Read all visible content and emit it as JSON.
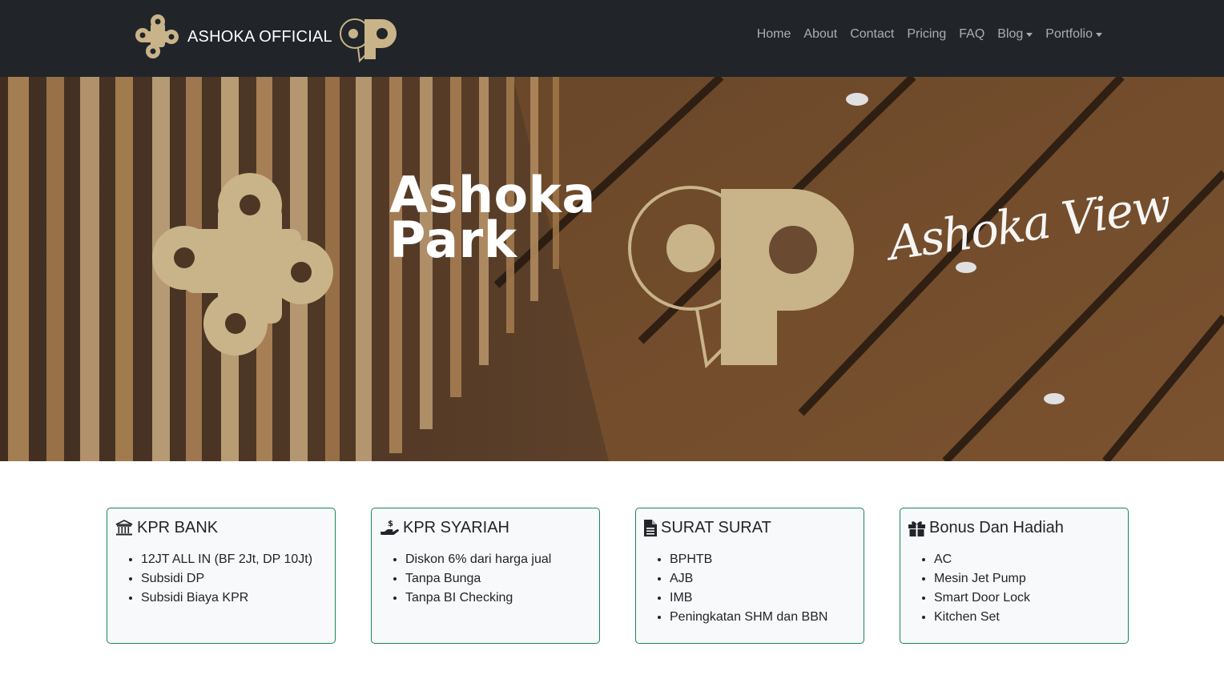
{
  "navbar": {
    "brand_text": "ASHOKA OFFICIAL",
    "links": [
      {
        "label": "Home"
      },
      {
        "label": "About"
      },
      {
        "label": "Contact"
      },
      {
        "label": "Pricing"
      },
      {
        "label": "FAQ"
      },
      {
        "label": "Blog"
      },
      {
        "label": "Portfolio"
      }
    ]
  },
  "hero": {
    "title_line1": "Ashoka",
    "title_line2": "Park",
    "script_text": "Ashoka View",
    "logo_color": "#c9b48a"
  },
  "cards": [
    {
      "icon": "bank-icon",
      "title": "KPR BANK",
      "items": [
        "12JT ALL IN (BF 2Jt, DP 10Jt)",
        "Subsidi DP",
        "Subsidi Biaya KPR"
      ]
    },
    {
      "icon": "hand-dollar-icon",
      "title": "KPR SYARIAH",
      "items": [
        "Diskon 6% dari harga jual",
        "Tanpa Bunga",
        "Tanpa BI Checking"
      ]
    },
    {
      "icon": "document-icon",
      "title": "SURAT SURAT",
      "items": [
        "BPHTB",
        "AJB",
        "IMB",
        "Peningkatan SHM dan BBN"
      ]
    },
    {
      "icon": "gift-icon",
      "title": "Bonus Dan Hadiah",
      "items": [
        "AC",
        "Mesin Jet Pump",
        "Smart Door Lock",
        "Kitchen Set"
      ]
    }
  ],
  "colors": {
    "navbar_bg": "#212529",
    "card_border": "#198754",
    "card_bg": "#f8f9fa",
    "gold": "#c9b48a"
  }
}
